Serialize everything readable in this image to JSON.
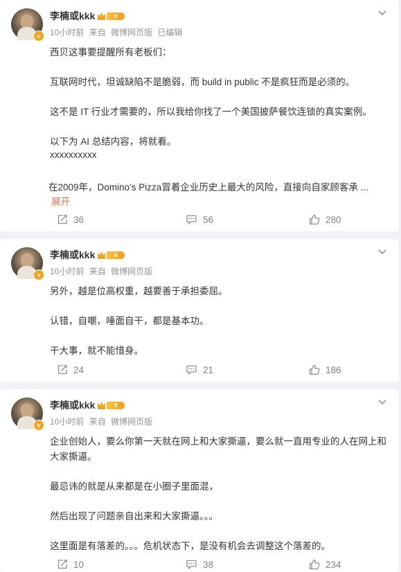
{
  "posts": [
    {
      "username": "李楠或kkk",
      "level_badge": "II",
      "meta": {
        "time": "10小时前",
        "from": "来自",
        "source": "微博网页版",
        "edited": "已编辑"
      },
      "lines": [
        "西贝这事要提醒所有老板们：",
        "互联网时代，坦诚缺陷不是脆弱，而 build in public 不是疯狂而是必须的。",
        "这不是 IT 行业才需要的，所以我给你找了一个美国披萨餐饮连锁的真实案例。",
        "以下为 AI 总结内容，将就看。",
        "xxxxxxxxxx",
        "在2009年，Domino’s Pizza冒着企业历史上最大的风险，直接向自家顾客承  ..."
      ],
      "expand_label": "展开",
      "reposts": "36",
      "comments": "56",
      "likes": "280"
    },
    {
      "username": "李楠或kkk",
      "level_badge": "II",
      "meta": {
        "time": "10小时前",
        "from": "来自",
        "source": "微博网页版",
        "edited": ""
      },
      "lines": [
        "另外，越是位高权重，越要善于承担委屈。",
        "认错，自嘲，唾面自干，都是基本功。",
        "干大事，就不能惜身。"
      ],
      "expand_label": "",
      "reposts": "24",
      "comments": "21",
      "likes": "186"
    },
    {
      "username": "李楠或kkk",
      "level_badge": "II",
      "meta": {
        "time": "10小时前",
        "from": "来自",
        "source": "微博网页版",
        "edited": ""
      },
      "lines": [
        "企业创始人，要么你第一天就在网上和大家撕逼，要么就一直用专业的人在网上和",
        "大家撕逼。",
        "最忌讳的就是从来都是在小圈子里面混，",
        "然后出现了问题亲自出来和大家撕逼。。。",
        "这里面是有落差的。。。危机状态下，是没有机会去调整这个落差的。"
      ],
      "expand_label": "",
      "reposts": "10",
      "comments": "38",
      "likes": "234"
    }
  ],
  "colors": {
    "background": "#f1f2f5",
    "card": "#ffffff",
    "meta_text": "#939393",
    "expand": "#eb7350",
    "vip_badge": "#f7a21b"
  },
  "icons": [
    "chevron-down-icon",
    "repost-icon",
    "comment-icon",
    "like-icon",
    "crown-icon",
    "verified-badge-icon"
  ]
}
